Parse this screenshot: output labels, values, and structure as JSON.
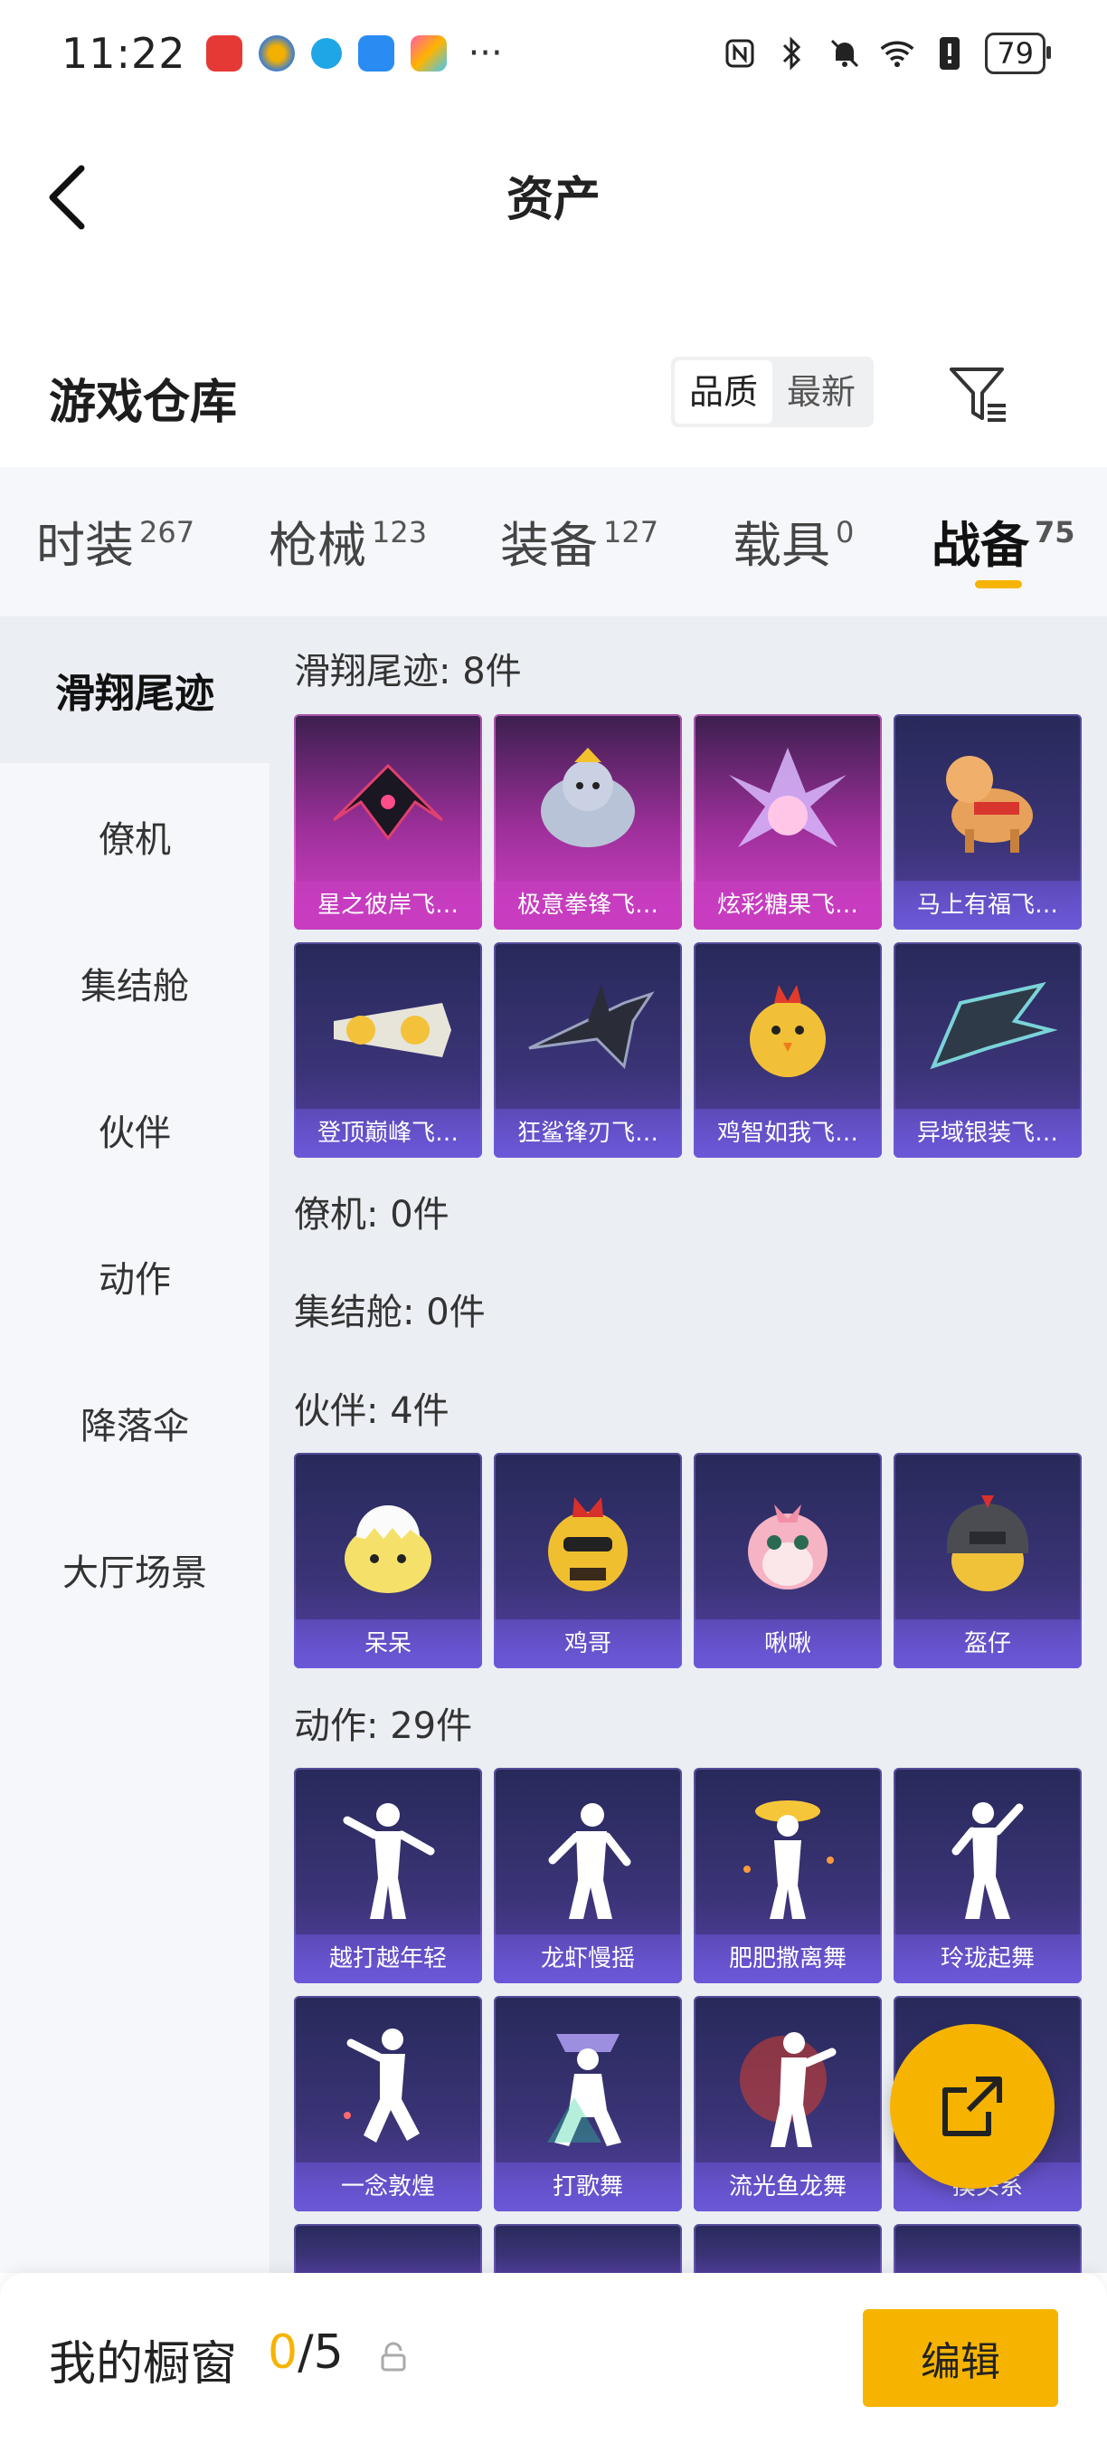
{
  "status_bar": {
    "time": "11:22",
    "more_indicator": "···",
    "battery": "79",
    "icons": [
      "nfc-icon",
      "bluetooth-icon",
      "mute-icon",
      "wifi-icon",
      "alert-icon"
    ]
  },
  "header": {
    "title": "资产"
  },
  "warehouse": {
    "title": "游戏仓库",
    "sort_options": [
      "品质",
      "最新"
    ],
    "sort_active": "品质"
  },
  "tabs": [
    {
      "label": "时装",
      "count": "267"
    },
    {
      "label": "枪械",
      "count": "123"
    },
    {
      "label": "装备",
      "count": "127"
    },
    {
      "label": "载具",
      "count": "0"
    },
    {
      "label": "战备",
      "count": "75"
    }
  ],
  "active_tab": "战备",
  "sidebar": {
    "items": [
      "滑翔尾迹",
      "僚机",
      "集结舱",
      "伙伴",
      "动作",
      "降落伞",
      "大厅场景"
    ],
    "active": "滑翔尾迹"
  },
  "sections": [
    {
      "title": "滑翔尾迹: 8件",
      "items": [
        "星之彼岸飞…",
        "极意拳锋飞…",
        "炫彩糖果飞…",
        "马上有福飞…",
        "登顶巅峰飞…",
        "狂鲨锋刃飞…",
        "鸡智如我飞…",
        "异域银装飞…"
      ]
    },
    {
      "title": "僚机: 0件",
      "items": []
    },
    {
      "title": "集结舱: 0件",
      "items": []
    },
    {
      "title": "伙伴: 4件",
      "items": [
        "呆呆",
        "鸡哥",
        "啾啾",
        "盔仔"
      ]
    },
    {
      "title": "动作: 29件",
      "items": [
        "越打越年轻",
        "龙虾慢摇",
        "肥肥撒离舞",
        "玲珑起舞",
        "一念敦煌",
        "打歌舞",
        "流光鱼龙舞",
        "摸头系"
      ]
    }
  ],
  "bottom_bar": {
    "label": "我的橱窗",
    "current": "0",
    "total": "/5",
    "edit_label": "编辑"
  },
  "colors": {
    "accent": "#f6b400",
    "purple_card": "#3b3477",
    "pink_card": "#a0309c"
  }
}
